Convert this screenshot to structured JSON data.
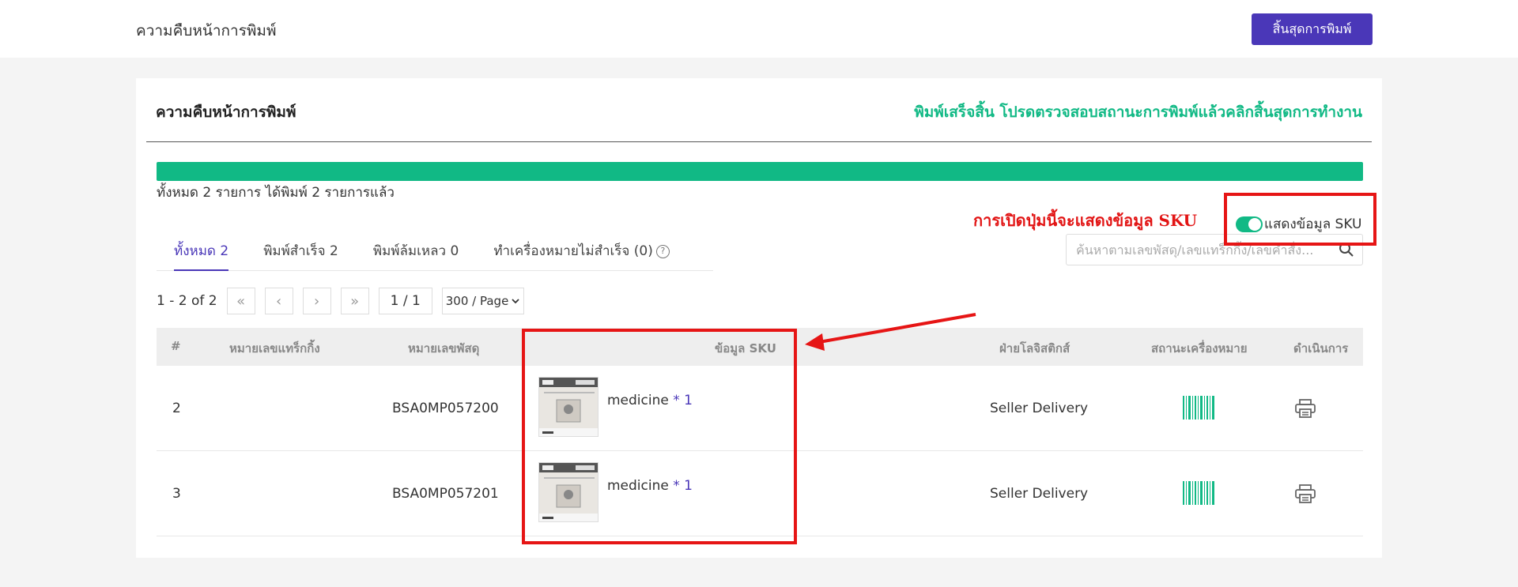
{
  "header": {
    "title": "ความคืบหน้าการพิมพ์",
    "finish_button": "สิ้นสุดการพิมพ์"
  },
  "card": {
    "title": "ความคืบหน้าการพิมพ์",
    "status": "พิมพ์เสร็จสิ้น โปรดตรวจสอบสถานะการพิมพ์แล้วคลิกสิ้นสุดการทำงาน",
    "progress_percent": 100,
    "summary": "ทั้งหมด 2 รายการ ได้พิมพ์ 2 รายการแล้ว"
  },
  "tabs": [
    {
      "label": "ทั้งหมด 2",
      "active": true
    },
    {
      "label": "พิมพ์สำเร็จ 2",
      "active": false
    },
    {
      "label": "พิมพ์ล้มเหลว 0",
      "active": false
    },
    {
      "label": "ทำเครื่องหมายไม่สำเร็จ (0)",
      "active": false
    }
  ],
  "search": {
    "placeholder": "ค้นหาตามเลขพัสดุ/เลขแทร็กกิ้ง/เลขคำสั่ง..."
  },
  "pager": {
    "range": "1 - 2 of 2",
    "page": "1 / 1",
    "page_size": "300 / Page"
  },
  "annotation": "การเปิดปุ่มนี้จะแสดงข้อมูล SKU",
  "sku_toggle": {
    "label": "แสดงข้อมูล SKU",
    "on": true
  },
  "table": {
    "headers": {
      "index": "#",
      "tracking": "หมายเลขแทร็กกิ้ง",
      "parcel": "หมายเลขพัสดุ",
      "sku": "ข้อมูล SKU",
      "logistics": "ฝ่ายโลจิสติกส์",
      "mark_status": "สถานะเครื่องหมาย",
      "action": "ดำเนินการ"
    },
    "rows": [
      {
        "index": "2",
        "tracking": "",
        "parcel": "BSA0MP057200",
        "sku_name": "medicine",
        "sku_qty": "* 1",
        "logistics": "Seller Delivery"
      },
      {
        "index": "3",
        "tracking": "",
        "parcel": "BSA0MP057201",
        "sku_name": "medicine",
        "sku_qty": "* 1",
        "logistics": "Seller Delivery"
      }
    ]
  },
  "colors": {
    "brand": "#4a37b8",
    "success": "#11b985",
    "annotation": "#e21414"
  }
}
